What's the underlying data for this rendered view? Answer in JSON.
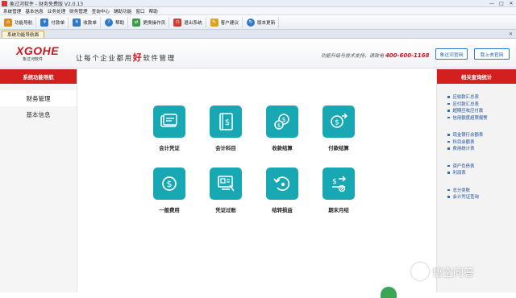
{
  "window": {
    "title": "象过河软件 - 财务免费版 V2.0.13",
    "controls": [
      "—",
      "□",
      "✕"
    ]
  },
  "menu": [
    "系统管理",
    "基本信息",
    "业务处理",
    "财务管理",
    "查询中心",
    "辅助功能",
    "窗口",
    "帮助"
  ],
  "toolbar": [
    {
      "label": "功能导航",
      "icon": "home-icon",
      "color": "#e08a1e"
    },
    {
      "label": "付款单",
      "icon": "payment-icon",
      "color": "#2f78c8"
    },
    {
      "label": "收款单",
      "icon": "receipt-icon",
      "color": "#2f78c8"
    },
    {
      "label": "帮助",
      "icon": "help-icon",
      "color": "#2f78c8"
    },
    {
      "label": "更换操作员",
      "icon": "switch-user-icon",
      "color": "#3a9a4a"
    },
    {
      "label": "退出系统",
      "icon": "exit-icon",
      "color": "#d23a2a"
    },
    {
      "label": "客户建议",
      "icon": "suggestion-icon",
      "color": "#e0a21e"
    },
    {
      "label": "版本更新",
      "icon": "update-icon",
      "color": "#2f78c8"
    }
  ],
  "tab": {
    "label": "系统功能导航面",
    "close": "✕"
  },
  "header": {
    "logo_brand": "XGOHE",
    "logo_sub": "象过河软件",
    "slogan_pre": "让每个企业都用",
    "slogan_big": "好",
    "slogan_post": "软件管理",
    "support_text": "功能升级与技术支持，请致电",
    "support_phone": "400-600-1168",
    "btn_official": "象过河官网",
    "btn_gov": "我上去官网"
  },
  "left_panel": {
    "title": "系统功能导航",
    "items": [
      "财务管理",
      "基本信息"
    ]
  },
  "right_panel": {
    "title": "相关查询统计",
    "groups": [
      [
        "应收款汇总表",
        "应付款汇总表",
        "超期应收应付款",
        "信用额度超限报警"
      ],
      [
        "现金银行余额表",
        "科目余额表",
        "费用统计表"
      ],
      [
        "资产负债表",
        "利润表"
      ],
      [
        "总分类账",
        "会计凭证查询"
      ]
    ]
  },
  "functions": [
    {
      "label": "会计凭证",
      "icon": "voucher-icon"
    },
    {
      "label": "会计科目",
      "icon": "ledger-icon"
    },
    {
      "label": "收款结算",
      "icon": "collection-icon"
    },
    {
      "label": "付款结算",
      "icon": "settlement-payment-icon"
    },
    {
      "label": "一般费用",
      "icon": "expense-icon"
    },
    {
      "label": "凭证过账",
      "icon": "posting-icon"
    },
    {
      "label": "结转损益",
      "icon": "carry-forward-icon"
    },
    {
      "label": "期末月结",
      "icon": "month-end-icon"
    }
  ],
  "watermark": "悟空问答"
}
